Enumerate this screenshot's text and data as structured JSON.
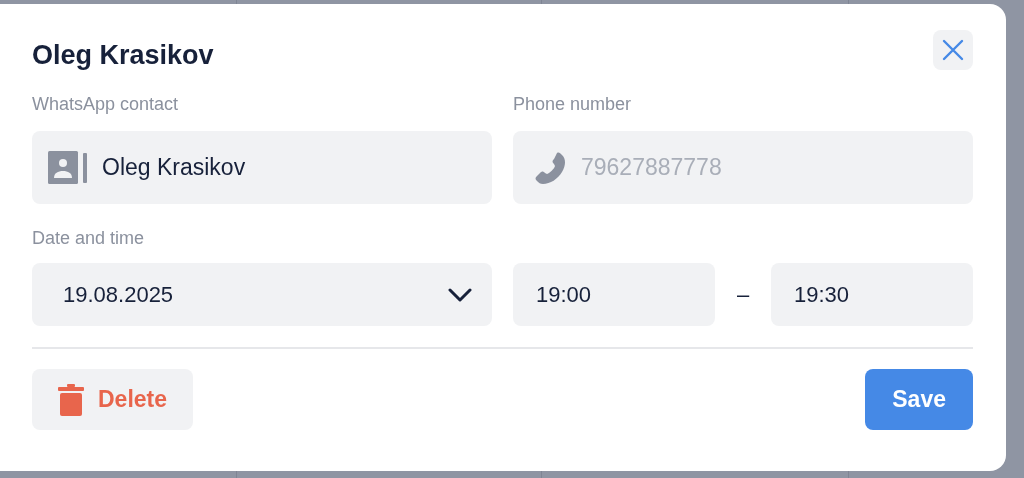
{
  "dialog": {
    "title": "Oleg Krasikov",
    "contact": {
      "label": "WhatsApp contact",
      "value": "Oleg Krasikov"
    },
    "phone": {
      "label": "Phone number",
      "placeholder": "79627887778"
    },
    "date_time": {
      "label": "Date and time",
      "date": "19.08.2025",
      "start": "19:00",
      "separator": "–",
      "end": "19:30"
    },
    "buttons": [
      {
        "kind": "delete",
        "label": "Delete"
      },
      {
        "kind": "save",
        "label": "Save"
      }
    ]
  }
}
